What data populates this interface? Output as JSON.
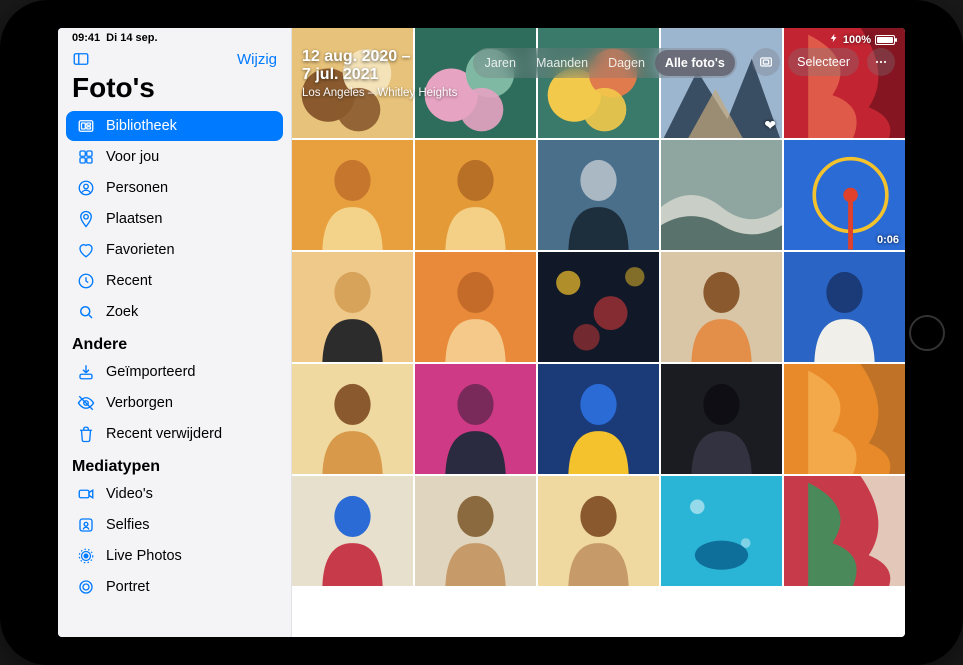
{
  "status": {
    "time": "09:41",
    "date": "Di 14 sep.",
    "battery_pct": "100%",
    "battery_icon_name": "battery-full-icon",
    "charging_icon_name": "bolt-icon"
  },
  "sidebar": {
    "edit_label": "Wijzig",
    "app_title": "Foto's",
    "items": [
      {
        "icon": "library",
        "label": "Bibliotheek",
        "selected": true
      },
      {
        "icon": "foryou",
        "label": "Voor jou",
        "selected": false
      },
      {
        "icon": "people",
        "label": "Personen",
        "selected": false
      },
      {
        "icon": "places",
        "label": "Plaatsen",
        "selected": false
      },
      {
        "icon": "heart",
        "label": "Favorieten",
        "selected": false
      },
      {
        "icon": "clock",
        "label": "Recent",
        "selected": false
      },
      {
        "icon": "search",
        "label": "Zoek",
        "selected": false
      }
    ],
    "sections": [
      {
        "title": "Andere",
        "items": [
          {
            "icon": "import",
            "label": "Geïmporteerd"
          },
          {
            "icon": "hidden",
            "label": "Verborgen"
          },
          {
            "icon": "trash",
            "label": "Recent verwijderd"
          }
        ]
      },
      {
        "title": "Mediatypen",
        "items": [
          {
            "icon": "video",
            "label": "Video's"
          },
          {
            "icon": "selfie",
            "label": "Selfies"
          },
          {
            "icon": "live",
            "label": "Live Photos"
          },
          {
            "icon": "portrait",
            "label": "Portret"
          }
        ]
      }
    ]
  },
  "main": {
    "date_range_line1": "12 aug. 2020 –",
    "date_range_line2": "7 jul. 2021",
    "location": "Los Angeles – Whitley Heights",
    "segments": [
      "Jaren",
      "Maanden",
      "Dagen",
      "Alle foto's"
    ],
    "segment_active_index": 3,
    "select_label": "Selecteer",
    "aspect_button_name": "aspect-ratio-button",
    "more_button_name": "more-button",
    "grid": {
      "cols": 5,
      "photos": [
        {
          "palette": [
            "#e7c27a",
            "#8a5a2e",
            "#f4e2b8"
          ],
          "subject": "food"
        },
        {
          "palette": [
            "#2e6c5b",
            "#e7a3c2",
            "#7fb8a3"
          ],
          "subject": "macarons"
        },
        {
          "palette": [
            "#3a7a6a",
            "#f3c94b",
            "#e07b4d"
          ],
          "subject": "macarons"
        },
        {
          "palette": [
            "#9db6d0",
            "#3a4e63",
            "#c3a87a"
          ],
          "subject": "mountains",
          "favorite": true
        },
        {
          "palette": [
            "#c32431",
            "#e05a4a",
            "#7a141e"
          ],
          "subject": "red-fabric"
        },
        {
          "palette": [
            "#e8a03e",
            "#f3d38a",
            "#c7762e"
          ],
          "subject": "two-people"
        },
        {
          "palette": [
            "#e49a36",
            "#f4cf86",
            "#b86f26"
          ],
          "subject": "two-people"
        },
        {
          "palette": [
            "#4a6f8a",
            "#1d2e3c",
            "#aab8c4"
          ],
          "subject": "portrait-m"
        },
        {
          "palette": [
            "#8fa6a0",
            "#c9cfc6",
            "#3e5a55"
          ],
          "subject": "ocean-wave"
        },
        {
          "palette": [
            "#2a6bd6",
            "#e0412a",
            "#f3c22c"
          ],
          "subject": "ferris-wheel",
          "video_duration": "0:06"
        },
        {
          "palette": [
            "#efc98a",
            "#2c2c2c",
            "#d7a35a"
          ],
          "subject": "selfie-f"
        },
        {
          "palette": [
            "#e98a3a",
            "#f4c98a",
            "#c46b2a"
          ],
          "subject": "portrait-f"
        },
        {
          "palette": [
            "#111827",
            "#f3c22c",
            "#d33a3a"
          ],
          "subject": "bokeh-night"
        },
        {
          "palette": [
            "#d8c6a7",
            "#e38f4a",
            "#8a5a2e"
          ],
          "subject": "distant-person"
        },
        {
          "palette": [
            "#2a64c4",
            "#f0efe9",
            "#1a3a78"
          ],
          "subject": "portrait-m"
        },
        {
          "palette": [
            "#efd9a0",
            "#d89a4a",
            "#8a5a2e"
          ],
          "subject": "headscarf"
        },
        {
          "palette": [
            "#cf3a86",
            "#2a2a40",
            "#7a2a5a"
          ],
          "subject": "portrait-pink"
        },
        {
          "palette": [
            "#1a3a78",
            "#f3c22c",
            "#2a6bd6"
          ],
          "subject": "sunglasses"
        },
        {
          "palette": [
            "#1b1b22",
            "#323240",
            "#0e0e14"
          ],
          "subject": "dark-portrait"
        },
        {
          "palette": [
            "#e88a2a",
            "#f3a84a",
            "#b86f26"
          ],
          "subject": "dress-orange"
        },
        {
          "palette": [
            "#e7e0cc",
            "#c73a4a",
            "#2a6bd6"
          ],
          "subject": "dancer"
        },
        {
          "palette": [
            "#e0d6c0",
            "#c79a6a",
            "#8a6a3e"
          ],
          "subject": "desert-person"
        },
        {
          "palette": [
            "#efd9a0",
            "#c79a6a",
            "#8a5a2e"
          ],
          "subject": "person-beige"
        },
        {
          "palette": [
            "#2ab5d6",
            "#0e6f9a",
            "#8adcf0"
          ],
          "subject": "underwater"
        },
        {
          "palette": [
            "#c73a4a",
            "#4a8a5a",
            "#e7e0cc"
          ],
          "subject": "red-dress"
        }
      ]
    }
  },
  "colors": {
    "accent": "#007aff",
    "sidebar_bg": "#f4f4f6"
  }
}
